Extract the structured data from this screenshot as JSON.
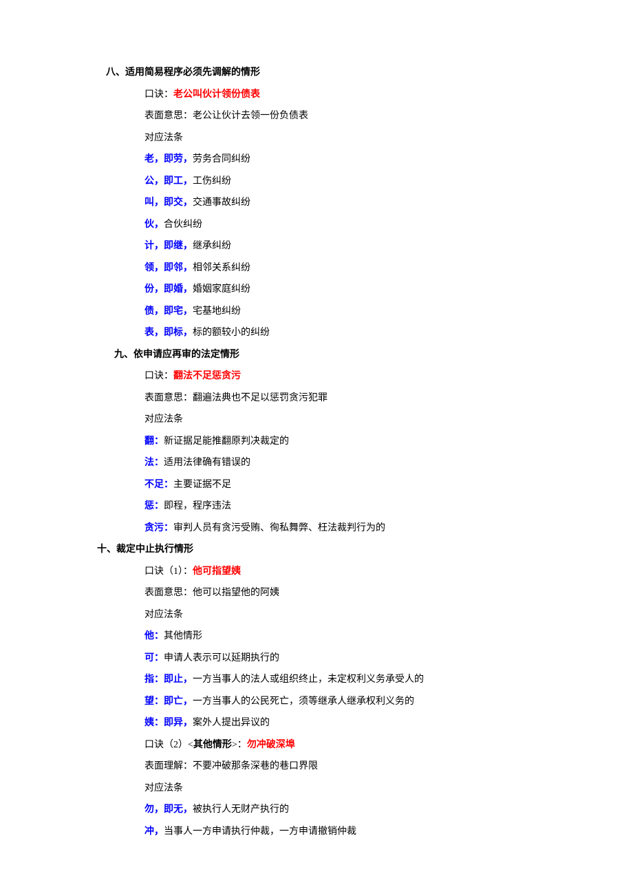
{
  "sections": [
    {
      "heading": "八、适用简易程序必须先调解的情形",
      "headClass": "h-8",
      "lines": [
        [
          {
            "t": "口诀：",
            "cls": ""
          },
          {
            "t": "老公叫伙计领份债表",
            "cls": "red bold"
          }
        ],
        [
          {
            "t": "表面意思：老公让伙计去领一份负债表",
            "cls": ""
          }
        ],
        [
          {
            "t": "对应法条",
            "cls": ""
          }
        ],
        [
          {
            "t": "老，即劳，",
            "cls": "blue bold"
          },
          {
            "t": "劳务合同纠纷",
            "cls": ""
          }
        ],
        [
          {
            "t": "公，即工，",
            "cls": "blue bold"
          },
          {
            "t": "工伤纠纷",
            "cls": ""
          }
        ],
        [
          {
            "t": "叫，即交，",
            "cls": "blue bold"
          },
          {
            "t": "交通事故纠纷",
            "cls": ""
          }
        ],
        [
          {
            "t": "伙，",
            "cls": "blue bold"
          },
          {
            "t": "合伙纠纷",
            "cls": ""
          }
        ],
        [
          {
            "t": "计，即继，",
            "cls": "blue bold"
          },
          {
            "t": "继承纠纷",
            "cls": ""
          }
        ],
        [
          {
            "t": "领，即邻，",
            "cls": "blue bold"
          },
          {
            "t": "相邻关系纠纷",
            "cls": ""
          }
        ],
        [
          {
            "t": "份，即婚，",
            "cls": "blue bold"
          },
          {
            "t": "婚姻家庭纠纷",
            "cls": ""
          }
        ],
        [
          {
            "t": "债，即宅，",
            "cls": "blue bold"
          },
          {
            "t": "宅基地纠纷",
            "cls": ""
          }
        ],
        [
          {
            "t": "表，即标，",
            "cls": "blue bold"
          },
          {
            "t": "标的额较小的纠纷",
            "cls": ""
          }
        ]
      ]
    },
    {
      "heading": "九、依申请应再审的法定情形",
      "headClass": "h-9",
      "lines": [
        [
          {
            "t": "口诀：",
            "cls": ""
          },
          {
            "t": "翻法不足惩贪污",
            "cls": "red bold"
          }
        ],
        [
          {
            "t": "表面意思：翻遍法典也不足以惩罚贪污犯罪",
            "cls": ""
          }
        ],
        [
          {
            "t": "对应法条",
            "cls": ""
          }
        ],
        [
          {
            "t": "翻：",
            "cls": "blue bold"
          },
          {
            "t": "新证据足能推翻原判决裁定的",
            "cls": ""
          }
        ],
        [
          {
            "t": "法：",
            "cls": "blue bold"
          },
          {
            "t": "适用法律确有错误的",
            "cls": ""
          }
        ],
        [
          {
            "t": "不足：",
            "cls": "blue bold"
          },
          {
            "t": "主要证据不足",
            "cls": ""
          }
        ],
        [
          {
            "t": "惩：",
            "cls": "blue bold"
          },
          {
            "t": "即程，程序违法",
            "cls": ""
          }
        ],
        [
          {
            "t": "贪污：",
            "cls": "blue bold"
          },
          {
            "t": "审判人员有贪污受贿、徇私舞弊、枉法裁判行为的",
            "cls": ""
          }
        ]
      ]
    },
    {
      "heading": "十、裁定中止执行情形",
      "headClass": "h-10",
      "lines": [
        [
          {
            "t": "口诀（1）：",
            "cls": ""
          },
          {
            "t": "他可指望姨",
            "cls": "red bold"
          }
        ],
        [
          {
            "t": "表面意思：他可以指望他的阿姨",
            "cls": ""
          }
        ],
        [
          {
            "t": "对应法条",
            "cls": ""
          }
        ],
        [
          {
            "t": "他：",
            "cls": "blue bold"
          },
          {
            "t": "其他情形",
            "cls": ""
          }
        ],
        [
          {
            "t": "可：",
            "cls": "blue bold"
          },
          {
            "t": "申请人表示可以延期执行的",
            "cls": ""
          }
        ],
        [
          {
            "t": "指：即止，",
            "cls": "blue bold"
          },
          {
            "t": "一方当事人的法人或组织终止，未定权利义务承受人的",
            "cls": ""
          }
        ],
        [
          {
            "t": "望：即亡，",
            "cls": "blue bold"
          },
          {
            "t": "一方当事人的公民死亡，须等继承人继承权利义务的",
            "cls": ""
          }
        ],
        [
          {
            "t": "姨：即异，",
            "cls": "blue bold"
          },
          {
            "t": "案外人提出异议的",
            "cls": ""
          }
        ],
        [
          {
            "t": "口诀（2）<",
            "cls": ""
          },
          {
            "t": "其他情形",
            "cls": "bold"
          },
          {
            "t": ">：",
            "cls": ""
          },
          {
            "t": "勿冲破深埠",
            "cls": "red bold"
          }
        ],
        [
          {
            "t": "表面理解：不要冲破那条深巷的巷口界限",
            "cls": ""
          }
        ],
        [
          {
            "t": "对应法条",
            "cls": ""
          }
        ],
        [
          {
            "t": "勿，即无，",
            "cls": "blue bold"
          },
          {
            "t": "被执行人无财产执行的",
            "cls": ""
          }
        ],
        [
          {
            "t": "冲，",
            "cls": "blue bold"
          },
          {
            "t": "当事人一方申请执行仲裁，一方申请撤销仲裁",
            "cls": ""
          }
        ]
      ]
    }
  ]
}
